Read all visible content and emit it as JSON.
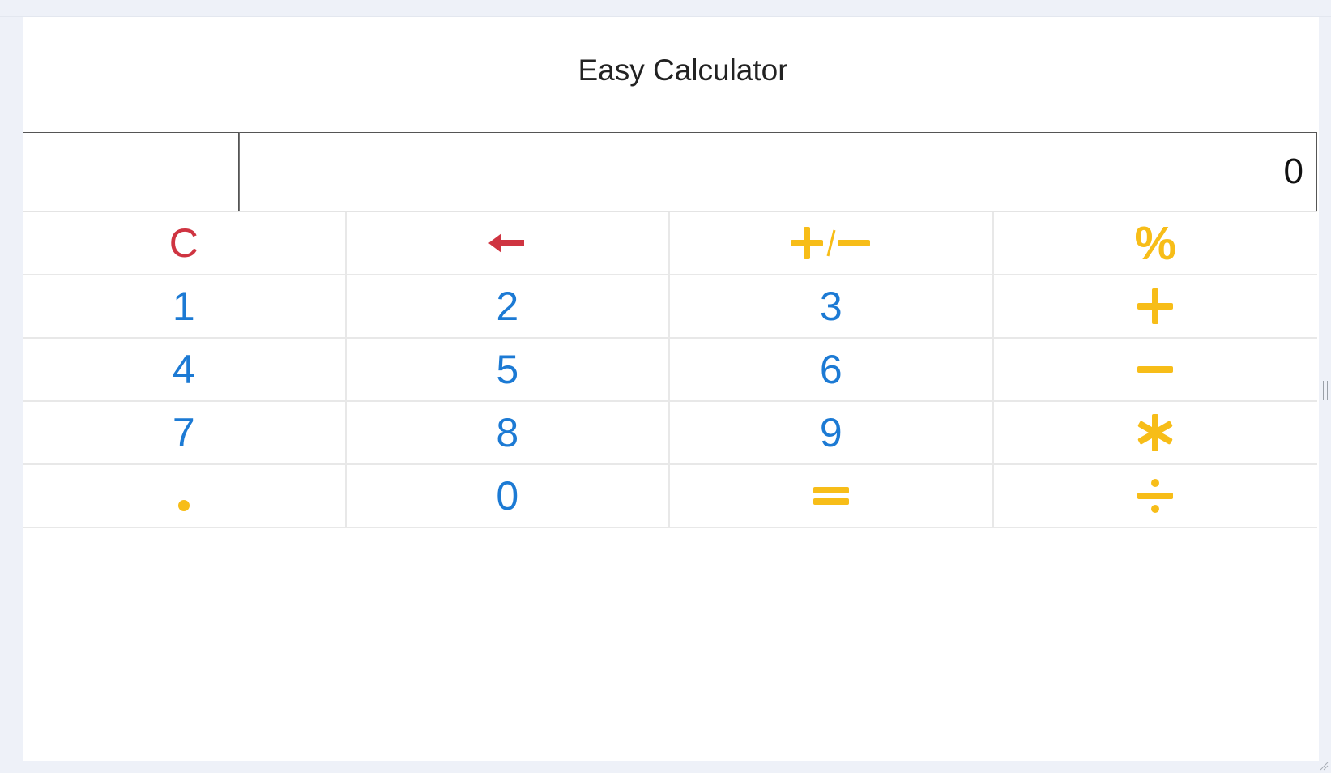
{
  "app": {
    "title": "Easy Calculator"
  },
  "display": {
    "history": "",
    "value": "0"
  },
  "keys": [
    {
      "id": "clear",
      "label": "C",
      "kind": "red",
      "icon": "clear"
    },
    {
      "id": "backspace",
      "label": "",
      "kind": "red",
      "icon": "arrow-left-icon"
    },
    {
      "id": "plus-minus",
      "label": "",
      "kind": "op",
      "icon": "plus-minus-icon"
    },
    {
      "id": "percent",
      "label": "%",
      "kind": "op",
      "icon": "percent"
    },
    {
      "id": "1",
      "label": "1",
      "kind": "num"
    },
    {
      "id": "2",
      "label": "2",
      "kind": "num"
    },
    {
      "id": "3",
      "label": "3",
      "kind": "num"
    },
    {
      "id": "add",
      "label": "",
      "kind": "op",
      "icon": "plus-icon"
    },
    {
      "id": "4",
      "label": "4",
      "kind": "num"
    },
    {
      "id": "5",
      "label": "5",
      "kind": "num"
    },
    {
      "id": "6",
      "label": "6",
      "kind": "num"
    },
    {
      "id": "subtract",
      "label": "",
      "kind": "op",
      "icon": "minus-icon"
    },
    {
      "id": "7",
      "label": "7",
      "kind": "num"
    },
    {
      "id": "8",
      "label": "8",
      "kind": "num"
    },
    {
      "id": "9",
      "label": "9",
      "kind": "num"
    },
    {
      "id": "multiply",
      "label": "",
      "kind": "op",
      "icon": "asterisk-icon"
    },
    {
      "id": "decimal",
      "label": "",
      "kind": "op",
      "icon": "dot-icon"
    },
    {
      "id": "0",
      "label": "0",
      "kind": "num"
    },
    {
      "id": "equals",
      "label": "",
      "kind": "op",
      "icon": "equals-icon"
    },
    {
      "id": "divide",
      "label": "",
      "kind": "op",
      "icon": "divide-icon"
    }
  ],
  "colors": {
    "number": "#1c7ad4",
    "operator": "#f7bd18",
    "danger": "#cf3441"
  }
}
